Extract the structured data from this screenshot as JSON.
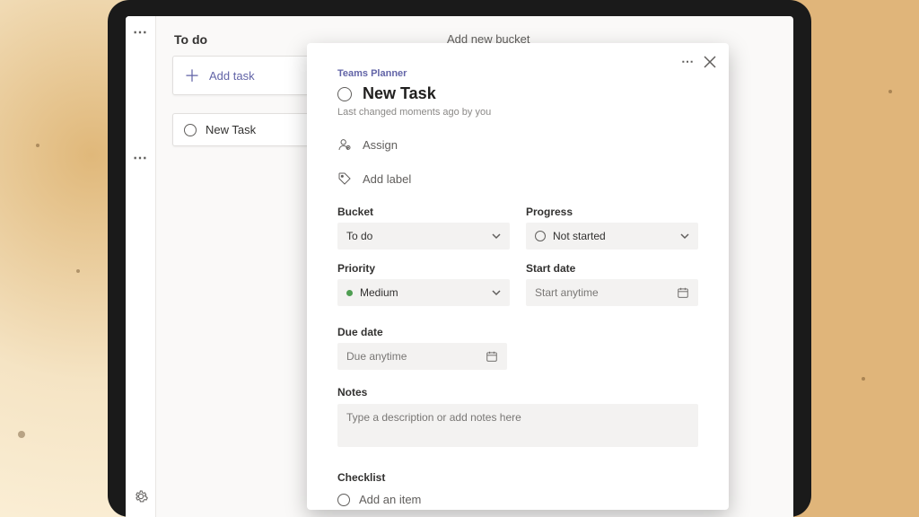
{
  "colors": {
    "accent": "#6264a7"
  },
  "board": {
    "bucket_title": "To do",
    "add_task_label": "Add task",
    "task_name": "New Task",
    "add_bucket_label": "Add new bucket"
  },
  "dialog": {
    "breadcrumb": "Teams Planner",
    "title": "New Task",
    "subtitle": "Last changed moments ago by you",
    "assign_label": "Assign",
    "add_label_label": "Add label",
    "fields": {
      "bucket": {
        "label": "Bucket",
        "value": "To do"
      },
      "progress": {
        "label": "Progress",
        "value": "Not started"
      },
      "priority": {
        "label": "Priority",
        "value": "Medium"
      },
      "start_date": {
        "label": "Start date",
        "placeholder": "Start anytime"
      },
      "due_date": {
        "label": "Due date",
        "placeholder": "Due anytime"
      }
    },
    "notes": {
      "label": "Notes",
      "placeholder": "Type a description or add notes here"
    },
    "checklist": {
      "label": "Checklist",
      "add_item": "Add an item"
    }
  }
}
